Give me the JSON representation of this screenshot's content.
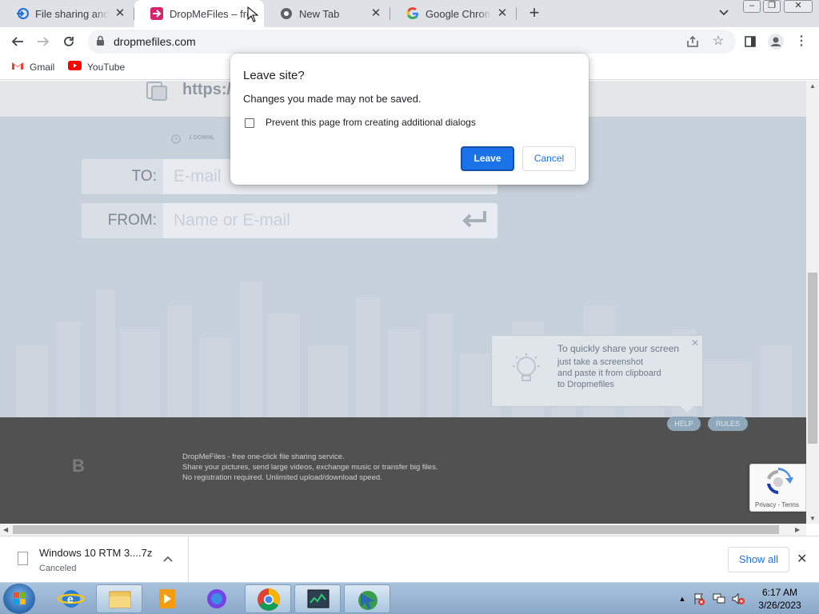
{
  "browser": {
    "tabs": [
      {
        "title": "File sharing and s",
        "favicon": "dropmefiles-blue-icon",
        "active": false
      },
      {
        "title": "DropMeFiles – fre",
        "favicon": "dropmefiles-arrow-icon",
        "active": true
      },
      {
        "title": "New Tab",
        "favicon": "chrome-icon",
        "active": false
      },
      {
        "title": "Google Chrome H",
        "favicon": "google-icon",
        "active": false
      }
    ],
    "address": "dropmefiles.com",
    "bookmarks": [
      {
        "label": "Gmail",
        "icon": "gmail-icon"
      },
      {
        "label": "YouTube",
        "icon": "youtube-icon"
      }
    ]
  },
  "page": {
    "url_prefix": "https:/",
    "downloads_text": "1 DOWNL",
    "to_label": "TO:",
    "to_placeholder": "E-mail",
    "from_label": "FROM:",
    "from_placeholder": "Name or E-mail",
    "tip": {
      "title": "To quickly share your screen",
      "lines": [
        "just take a screenshot",
        "and paste it from clipboard",
        "to Dropmefiles"
      ]
    },
    "help_label": "HELP",
    "rules_label": "RULES",
    "footer_logo": "B",
    "footer_lines": [
      "DropMeFiles - free one-click file sharing service.",
      "Share your pictures, send large videos, exchange music or transfer big files.",
      "No registration required. Unlimited upload/download speed."
    ],
    "recaptcha_links": "Privacy - Terms"
  },
  "dialog": {
    "title": "Leave site?",
    "message": "Changes you made may not be saved.",
    "checkbox_label": "Prevent this page from creating additional dialogs",
    "leave_label": "Leave",
    "cancel_label": "Cancel"
  },
  "download_bar": {
    "file_name": "Windows 10 RTM 3....7z",
    "status": "Canceled",
    "show_all_label": "Show all"
  },
  "taskbar": {
    "time": "6:17 AM",
    "date": "3/26/2023"
  },
  "colors": {
    "accent": "#1a73e8",
    "footer": "#515151",
    "page_bg": "#c7d1db"
  }
}
